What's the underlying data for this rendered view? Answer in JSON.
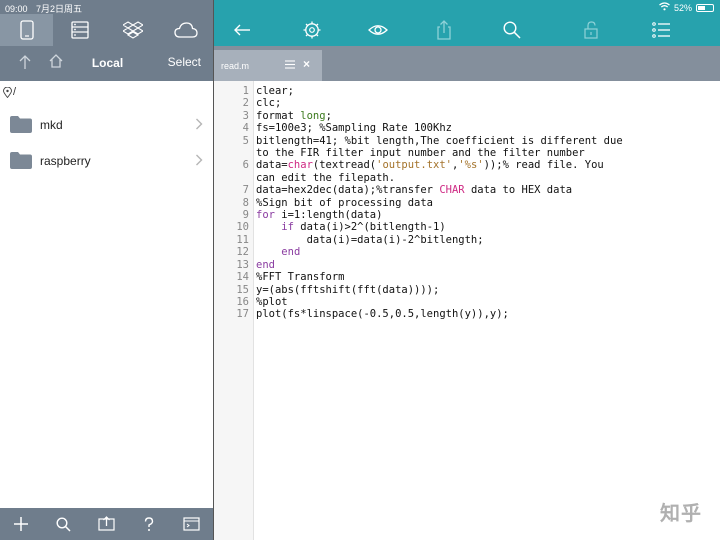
{
  "status": {
    "time": "09:00",
    "date": "7月2日周五",
    "battery": "52%",
    "battery_level": 0.52
  },
  "left": {
    "location_tabs": [
      "phone-icon",
      "server-icon",
      "dropbox-icon",
      "cloud-icon"
    ],
    "nav": {
      "title": "Local",
      "select_label": "Select"
    },
    "path": "/",
    "files": [
      {
        "name": "mkd"
      },
      {
        "name": "raspberry"
      }
    ],
    "bottom_icons": [
      "add-icon",
      "search-icon",
      "upload-icon",
      "help-icon",
      "terminal-icon"
    ]
  },
  "right": {
    "toolbar_icons": [
      "back-icon",
      "settings-icon",
      "eye-icon",
      "share-icon",
      "search-icon",
      "lock-icon",
      "outline-icon"
    ],
    "tab": {
      "name": "read.m",
      "close": "×"
    },
    "lines": [
      "clear;",
      "clc;",
      "format long;",
      "fs=100e3; %Sampling Rate 100Khz",
      "bitlength=41; %bit length,The coefficient is different due to the FIR filter input number and the filter number",
      "data=char(textread('output.txt','%s'));% read file. You can edit the filepath.",
      "data=hex2dec(data);%transfer CHAR data to HEX data",
      "%Sign bit of processing data",
      "for i=1:length(data)",
      "    if data(i)>2^(bitlength-1)",
      "        data(i)=data(i)-2^bitlength;",
      "    end",
      "end",
      "%FFT Transform",
      "y=(abs(fftshift(fft(data))));",
      "%plot",
      "plot(fs*linspace(-0.5,0.5,length(y)),y);"
    ]
  },
  "watermark": "知乎"
}
